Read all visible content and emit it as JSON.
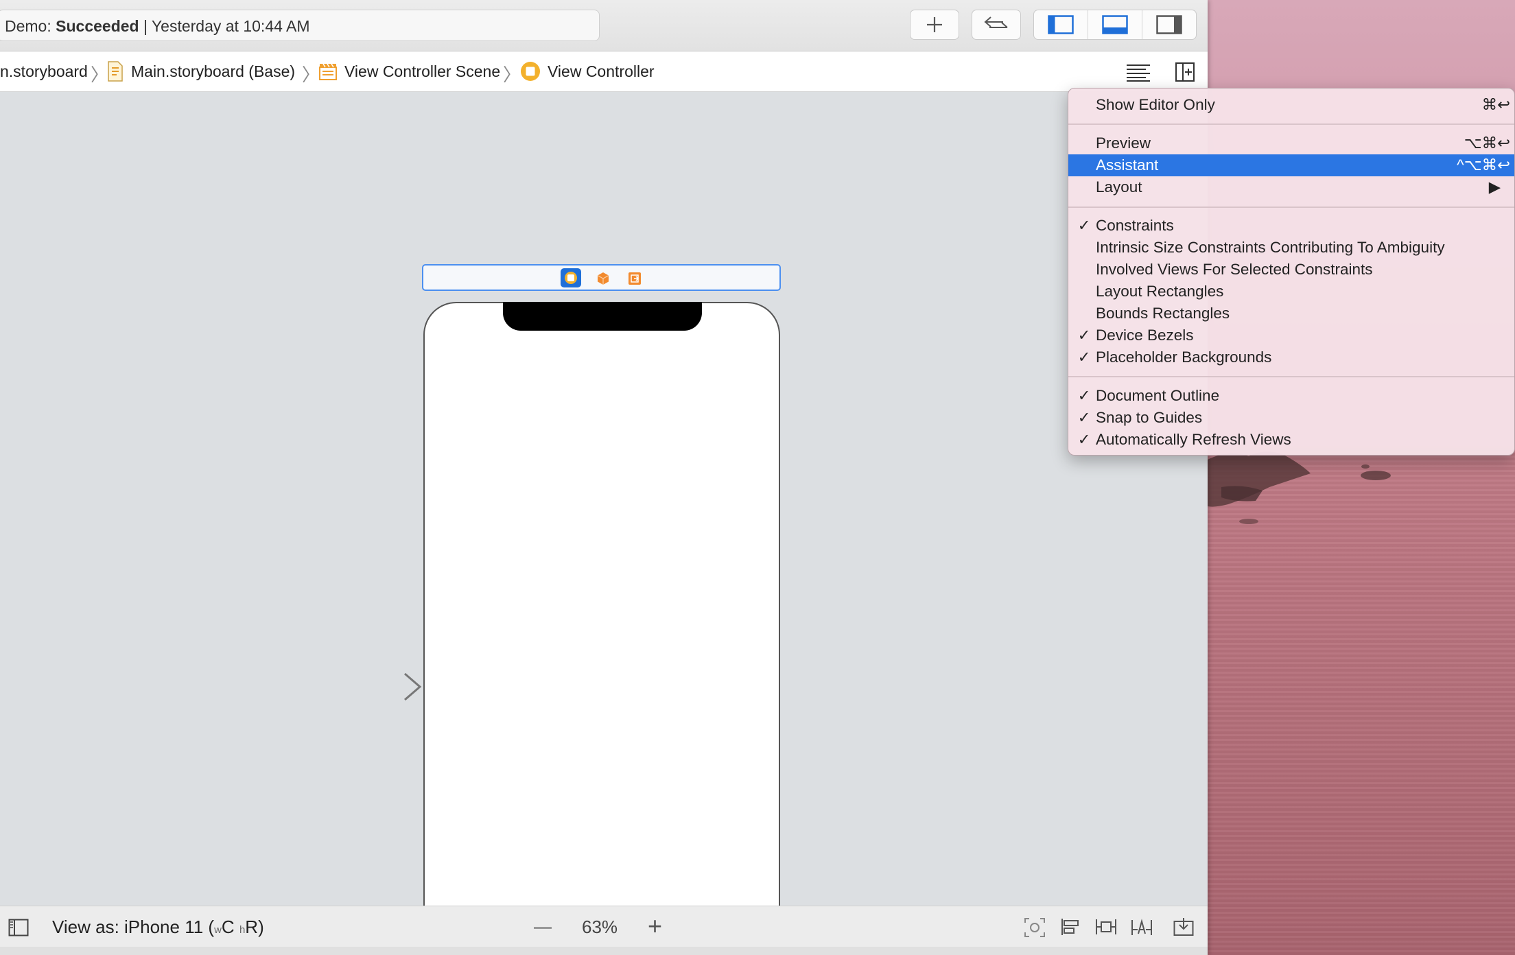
{
  "toolbar": {
    "activity_prefix": "Demo: ",
    "activity_status": "Succeeded",
    "activity_time": " | Yesterday at 10:44 AM",
    "add_icon": "plus-icon",
    "code_review_icon": "swap-arrows-icon"
  },
  "jumpbar": {
    "crumbs": [
      "n.storyboard",
      "Main.storyboard (Base)",
      "View Controller Scene",
      "View Controller"
    ]
  },
  "menu": {
    "items": [
      {
        "label": "Show Editor Only",
        "shortcut": "⌘↩"
      },
      {
        "label": "Preview",
        "shortcut": "⌥⌘↩"
      },
      {
        "label": "Assistant",
        "shortcut": "^⌥⌘↩"
      },
      {
        "label": "Layout",
        "shortcut": "▶"
      },
      {
        "label": "Constraints",
        "check": "✓"
      },
      {
        "label": "Intrinsic Size Constraints Contributing To Ambiguity"
      },
      {
        "label": "Involved Views For Selected Constraints"
      },
      {
        "label": "Layout Rectangles"
      },
      {
        "label": "Bounds Rectangles"
      },
      {
        "label": "Device Bezels",
        "check": "✓"
      },
      {
        "label": "Placeholder Backgrounds",
        "check": "✓"
      },
      {
        "label": "Document Outline",
        "check": "✓"
      },
      {
        "label": "Snap to Guides",
        "check": "✓"
      },
      {
        "label": "Automatically Refresh Views",
        "check": "✓"
      }
    ]
  },
  "bottombar": {
    "view_as_prefix": "View as: iPhone 11 (",
    "w_small": "w",
    "w_big": "C",
    "h_small": "h",
    "h_big": "R",
    "suffix": ")",
    "zoom_minus": "—",
    "zoom": "63%",
    "zoom_plus": "+"
  },
  "colors": {
    "accent": "#2b76e3",
    "scene_border": "#4b8ff0",
    "storyboard_orange": "#f0a030"
  }
}
